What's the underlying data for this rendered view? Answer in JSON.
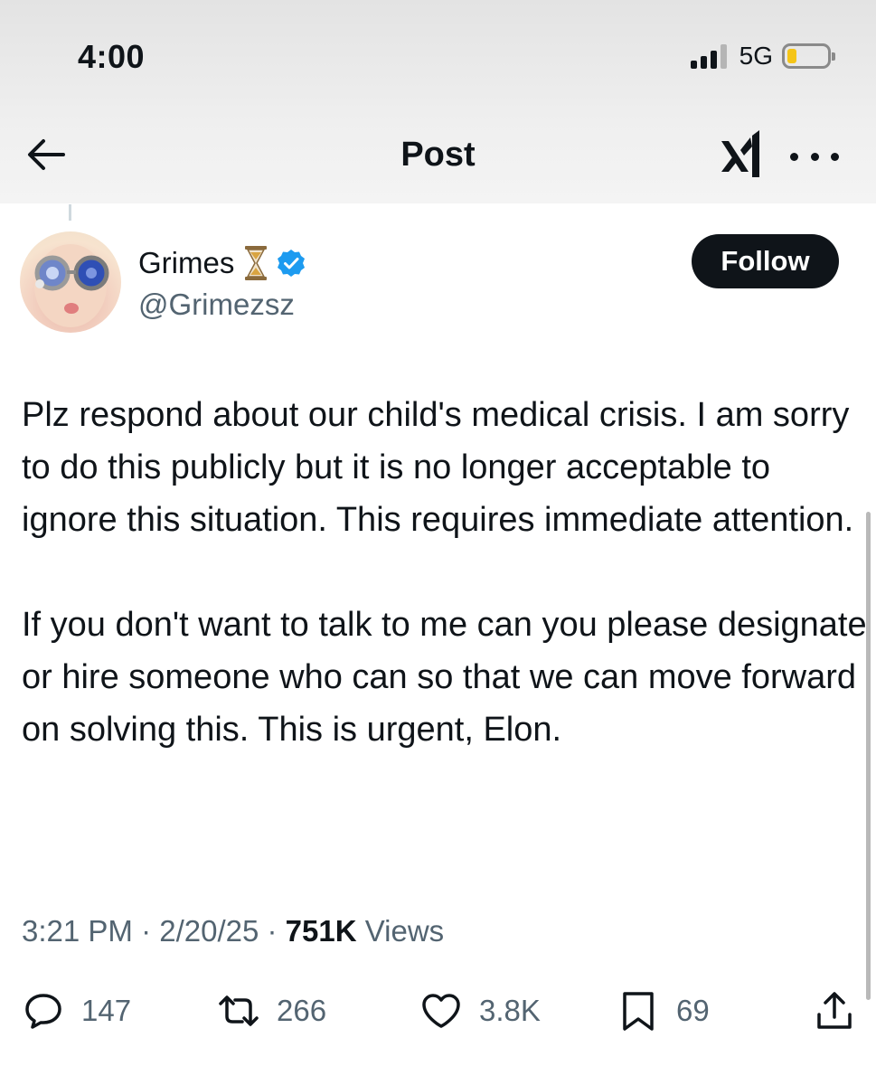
{
  "status_bar": {
    "time": "4:00",
    "network": "5G"
  },
  "header": {
    "title": "Post"
  },
  "author": {
    "name": "Grimes",
    "handle": "@Grimezsz"
  },
  "follow_label": "Follow",
  "tweet": {
    "paragraph_1": "Plz respond about our child's medical crisis.  I am sorry to do this publicly but it is no longer acceptable to ignore this situation.  This requires immediate attention.",
    "paragraph_2": "If you don't want to talk to me can you please designate or hire someone who can so that we can move forward on solving this.   This is urgent, Elon."
  },
  "meta": {
    "time": "3:21 PM",
    "date": "2/20/25",
    "views_count": "751K",
    "views_label": "Views"
  },
  "stats": {
    "replies": "147",
    "reposts": "266",
    "likes": "3.8K",
    "bookmarks": "69"
  },
  "colors": {
    "verified": "#1d9bf0",
    "follow_bg": "#0f1419",
    "muted_text": "#536471"
  }
}
